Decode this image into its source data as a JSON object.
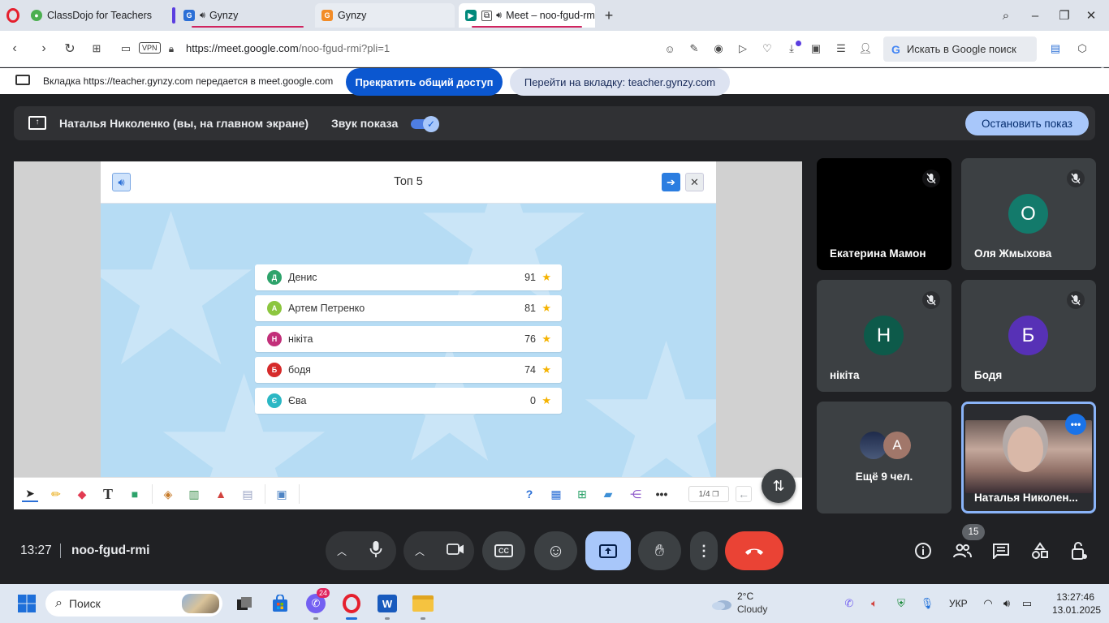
{
  "browser": {
    "tabs": [
      {
        "title": "ClassDojo for Teachers"
      },
      {
        "title": "Gynzy",
        "audio": true
      },
      {
        "title": "Gynzy"
      },
      {
        "title": "Meet – noo-fgud-rmi"
      }
    ],
    "url_host": "https://meet.google.com",
    "url_path": "/noo-fgud-rmi?pli=1",
    "vpn_label": "VPN",
    "search_placeholder": "Искать в Google поиск"
  },
  "share_notice": {
    "message": "Вкладка https://teacher.gynzy.com передается в meet.google.com",
    "stop_button": "Прекратить общий доступ",
    "goto_button": "Перейти на вкладку: teacher.gynzy.com"
  },
  "presenter_bar": {
    "presenter_name": "Наталья Николенко (вы, на главном экране)",
    "sound_label": "Звук показа",
    "sound_enabled": true,
    "stop_button": "Остановить показ"
  },
  "gynzy": {
    "title": "Топ 5",
    "leaderboard": [
      {
        "initial": "Д",
        "name": "Денис",
        "score": "91",
        "color": "#2ea36b"
      },
      {
        "initial": "А",
        "name": "Артем Петренко",
        "score": "81",
        "color": "#8cc63f"
      },
      {
        "initial": "Н",
        "name": "нікіта",
        "score": "76",
        "color": "#c2307a"
      },
      {
        "initial": "Б",
        "name": "бодя",
        "score": "74",
        "color": "#d62b2b"
      },
      {
        "initial": "Є",
        "name": "Єва",
        "score": "0",
        "color": "#2bb7c4"
      }
    ],
    "page_indicator": "1/4"
  },
  "participants": [
    {
      "name": "Екатерина Мамон",
      "initial": "",
      "avatar_color": "",
      "muted": true
    },
    {
      "name": "Оля Жмыхова",
      "initial": "О",
      "avatar_color": "#137a6b",
      "muted": true
    },
    {
      "name": "нікіта",
      "initial": "Н",
      "avatar_color": "#0d5a4a",
      "muted": true
    },
    {
      "name": "Бодя",
      "initial": "Б",
      "avatar_color": "#5731b6",
      "muted": true
    },
    {
      "name": "Ещё 9 чел.",
      "initial": "А",
      "avatar_color": "#a1776a",
      "muted": false
    },
    {
      "name": "Наталья Николен...",
      "initial": "",
      "avatar_color": "",
      "muted": false
    }
  ],
  "meeting": {
    "time": "13:27",
    "code": "noo-fgud-rmi",
    "participant_count": "15"
  },
  "taskbar": {
    "search_label": "Поиск",
    "viber_badge": "24",
    "temperature": "2°C",
    "weather": "Cloudy",
    "language": "УКР",
    "time": "13:27:46",
    "date": "13.01.2025"
  },
  "colors": {
    "meet_bg": "#202124",
    "accent_blue": "#0b57d0",
    "end_call_red": "#ea4335",
    "gynzy_blue": "#b6dcf4"
  }
}
